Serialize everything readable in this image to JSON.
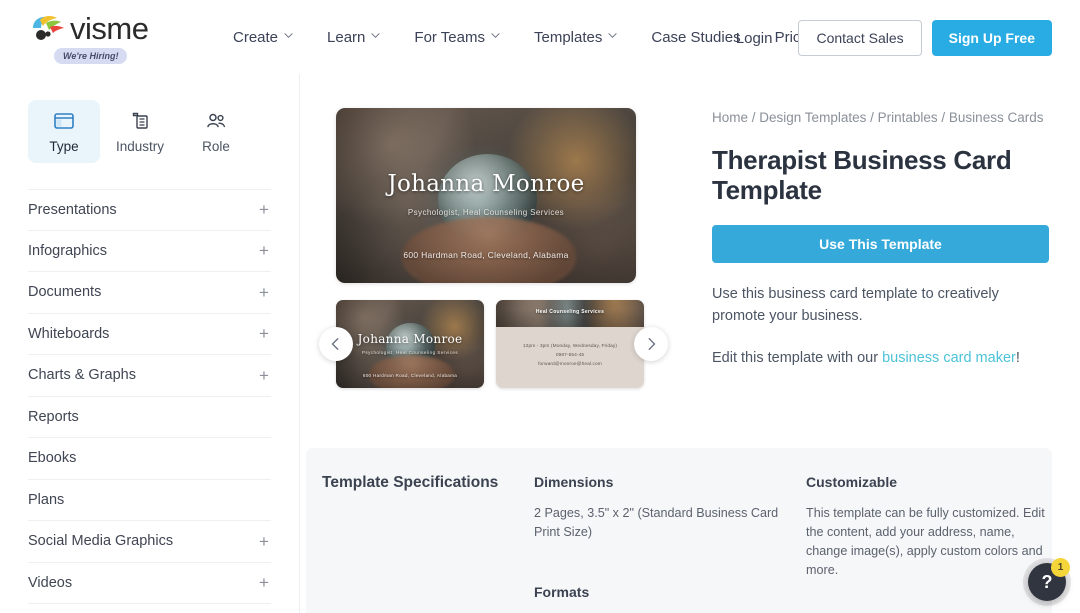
{
  "header": {
    "brand": "visme",
    "hiring_badge": "We're Hiring!",
    "nav": [
      {
        "label": "Create",
        "has_caret": true
      },
      {
        "label": "Learn",
        "has_caret": true
      },
      {
        "label": "For Teams",
        "has_caret": true
      },
      {
        "label": "Templates",
        "has_caret": true
      },
      {
        "label": "Case Studies",
        "has_caret": false
      },
      {
        "label": "Pricing",
        "has_caret": false
      }
    ],
    "login": "Login",
    "contact_sales": "Contact Sales",
    "sign_up": "Sign Up Free",
    "accent_color": "#29ace4"
  },
  "sidebar": {
    "facets": [
      {
        "label": "Type",
        "icon": "window-icon",
        "active": true
      },
      {
        "label": "Industry",
        "icon": "building-icon",
        "active": false
      },
      {
        "label": "Role",
        "icon": "people-icon",
        "active": false
      }
    ],
    "categories": [
      {
        "label": "Presentations",
        "expandable": true
      },
      {
        "label": "Infographics",
        "expandable": true
      },
      {
        "label": "Documents",
        "expandable": true
      },
      {
        "label": "Whiteboards",
        "expandable": true
      },
      {
        "label": "Charts & Graphs",
        "expandable": true
      },
      {
        "label": "Reports",
        "expandable": false
      },
      {
        "label": "Ebooks",
        "expandable": false
      },
      {
        "label": "Plans",
        "expandable": false
      },
      {
        "label": "Social Media Graphics",
        "expandable": true
      },
      {
        "label": "Videos",
        "expandable": true
      }
    ],
    "plus_glyph": "+"
  },
  "preview": {
    "card_front": {
      "name": "Johanna Monroe",
      "subtitle": "Psychologist, Heal Counseling Services",
      "address": "600 Hardman Road, Cleveland, Alabama"
    },
    "card_back": {
      "band_title": "Heal Counseling Services",
      "hours": "12pm - 3pm (Monday, Wednesday, Friday)",
      "phone": "0987-654-45",
      "email": "forward@monroe@heal.com"
    },
    "prev_label": "‹",
    "next_label": "›"
  },
  "details": {
    "breadcrumb": [
      "Home",
      "Design Templates",
      "Printables",
      "Business Cards"
    ],
    "breadcrumb_separator": "/",
    "title": "Therapist Business Card Template",
    "cta": "Use This Template",
    "description": "Use this business card template to creatively promote your business.",
    "edit_prefix": "Edit this template with our ",
    "edit_link": "business card maker",
    "edit_suffix": "!",
    "link_color": "#4cc2d8"
  },
  "specs": {
    "heading": "Template Specifications",
    "dimensions_label": "Dimensions",
    "dimensions_value": "2 Pages, 3.5\" x 2\" (Standard Business Card Print Size)",
    "formats_label": "Formats",
    "customizable_label": "Customizable",
    "customizable_value": "This template can be fully customized. Edit the content, add your address, name, change image(s), apply custom colors and more."
  },
  "help": {
    "glyph": "?",
    "badge_count": "1"
  }
}
